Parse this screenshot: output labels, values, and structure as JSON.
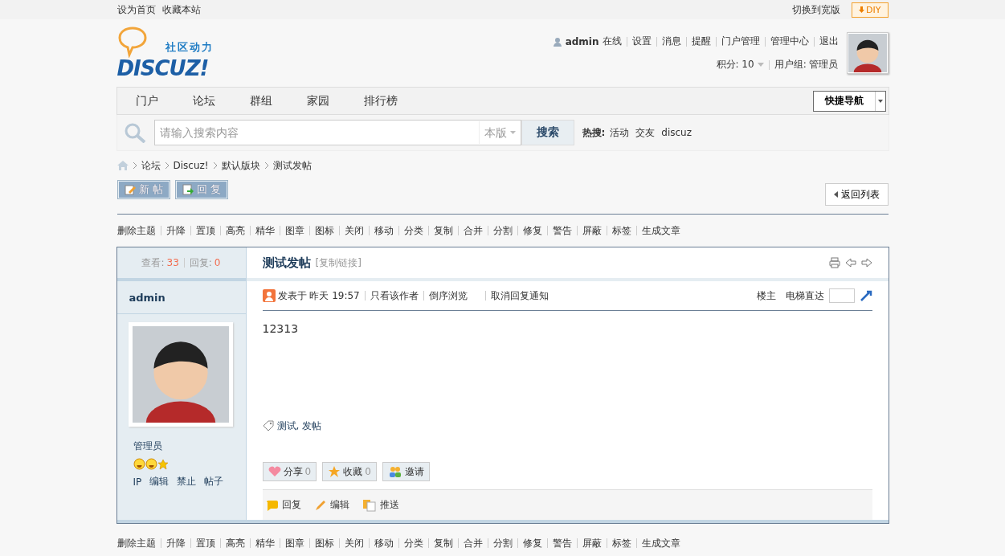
{
  "topbar": {
    "links": [
      "设为首页",
      "收藏本站"
    ],
    "switch": "切换到宽版",
    "diy": "DIY"
  },
  "logo": {
    "tagline": "社区动力",
    "name": "DISCUZ!"
  },
  "user": {
    "name": "admin",
    "status": "在线",
    "links": [
      "设置",
      "消息",
      "提醒",
      "门户管理",
      "管理中心",
      "退出"
    ],
    "credits": "积分: 10",
    "group": "用户组: 管理员"
  },
  "nav": {
    "items": [
      "门户",
      "论坛",
      "群组",
      "家园",
      "排行榜"
    ],
    "quick": "快捷导航"
  },
  "search": {
    "placeholder": "请输入搜索内容",
    "scope": "本版",
    "button": "搜索",
    "hot_label": "热搜:",
    "hot": [
      "活动",
      "交友",
      "discuz"
    ]
  },
  "breadcrumb": [
    "论坛",
    "Discuz!",
    "默认版块",
    "测试发帖"
  ],
  "actions": [
    {
      "kind": "new",
      "label": "新 帖"
    },
    {
      "kind": "reply",
      "label": "回 复"
    }
  ],
  "back": "返回列表",
  "mod_tools": [
    "删除主题",
    "升降",
    "置顶",
    "高亮",
    "精华",
    "图章",
    "图标",
    "关闭",
    "移动",
    "分类",
    "复制",
    "合并",
    "分割",
    "修复",
    "警告",
    "屏蔽",
    "标签",
    "生成文章"
  ],
  "post": {
    "views_label": "查看:",
    "views": "33",
    "replies_label": "回复:",
    "replies": "0",
    "title": "测试发帖",
    "copy_link": "[复制链接]",
    "author": "admin",
    "posted": "发表于 昨天 19:57",
    "links": [
      "只看该作者",
      "倒序浏览",
      "取消回复通知"
    ],
    "floor": "楼主",
    "jump_label": "电梯直达",
    "body": "12313",
    "tags": "测试, 发帖",
    "rank": "管理员",
    "rank_icons": [
      {
        "kind": "smile"
      },
      {
        "kind": "smile"
      },
      {
        "kind": "star"
      }
    ],
    "author_links": [
      "IP",
      "编辑",
      "禁止",
      "帖子"
    ],
    "buttons": [
      {
        "kind": "share",
        "label": "分享",
        "count": "0"
      },
      {
        "kind": "favorite",
        "label": "收藏",
        "count": "0"
      },
      {
        "kind": "invite",
        "label": "邀请"
      }
    ],
    "footer": [
      {
        "kind": "reply",
        "label": "回复"
      },
      {
        "kind": "edit",
        "label": "编辑"
      },
      {
        "kind": "push",
        "label": "推送"
      }
    ]
  },
  "mod_tools_bottom": [
    "删除主题",
    "升降",
    "置顶",
    "高亮",
    "精华",
    "图章",
    "图标",
    "关闭",
    "移动",
    "分类",
    "复制",
    "合并",
    "分割",
    "修复",
    "警告",
    "屏蔽",
    "标签",
    "生成文章"
  ]
}
